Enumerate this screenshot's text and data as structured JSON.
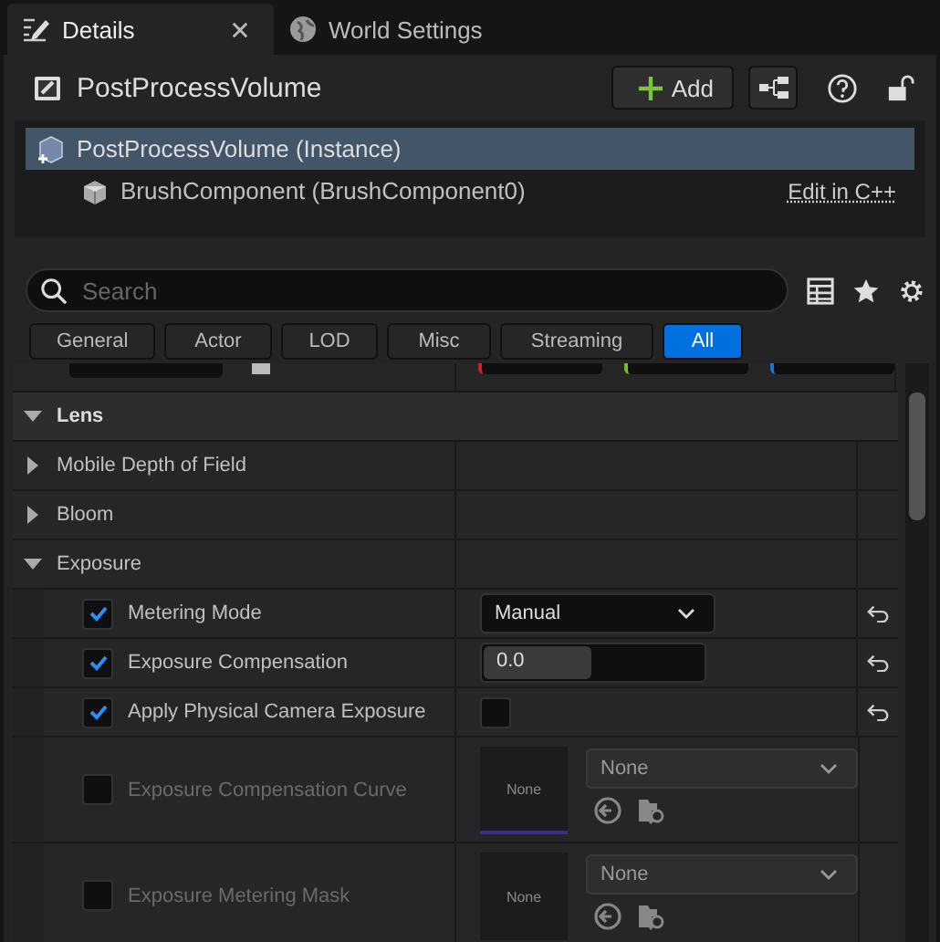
{
  "tabs": [
    {
      "label": "Details",
      "selected": true,
      "closable": true
    },
    {
      "label": "World Settings",
      "selected": false,
      "closable": false
    }
  ],
  "header": {
    "title": "PostProcessVolume",
    "add_button": "Add"
  },
  "components": [
    {
      "label": "PostProcessVolume (Instance)",
      "selected": true,
      "children": [
        {
          "label": "BrushComponent (BrushComponent0)",
          "selected": false,
          "link": "Edit in C++"
        }
      ]
    }
  ],
  "search": {
    "placeholder": "Search"
  },
  "filters": [
    {
      "label": "General",
      "selected": false
    },
    {
      "label": "Actor",
      "selected": false
    },
    {
      "label": "LOD",
      "selected": false
    },
    {
      "label": "Misc",
      "selected": false
    },
    {
      "label": "Streaming",
      "selected": false
    },
    {
      "label": "All",
      "selected": true
    }
  ],
  "properties": [
    {
      "kind": "category",
      "label": "Lens",
      "expanded": true
    },
    {
      "kind": "group",
      "label": "Mobile Depth of Field",
      "expanded": false
    },
    {
      "kind": "group",
      "label": "Bloom",
      "expanded": false
    },
    {
      "kind": "group",
      "label": "Exposure",
      "expanded": true
    },
    {
      "kind": "dropdown",
      "label": "Metering Mode",
      "checked": true,
      "value": "Manual"
    },
    {
      "kind": "number",
      "label": "Exposure Compensation",
      "checked": true,
      "value": "0.0",
      "level": 0.48
    },
    {
      "kind": "toggle",
      "label": "Apply Physical Camera Exposure",
      "checked": true,
      "on": false
    },
    {
      "kind": "asset",
      "label": "Exposure Compensation Curve",
      "checked": false,
      "thumbnail": "None",
      "value": "None",
      "color": "#3f2a8c"
    },
    {
      "kind": "asset",
      "label": "Exposure Metering Mask",
      "checked": false,
      "thumbnail": "None",
      "value": "None"
    }
  ]
}
